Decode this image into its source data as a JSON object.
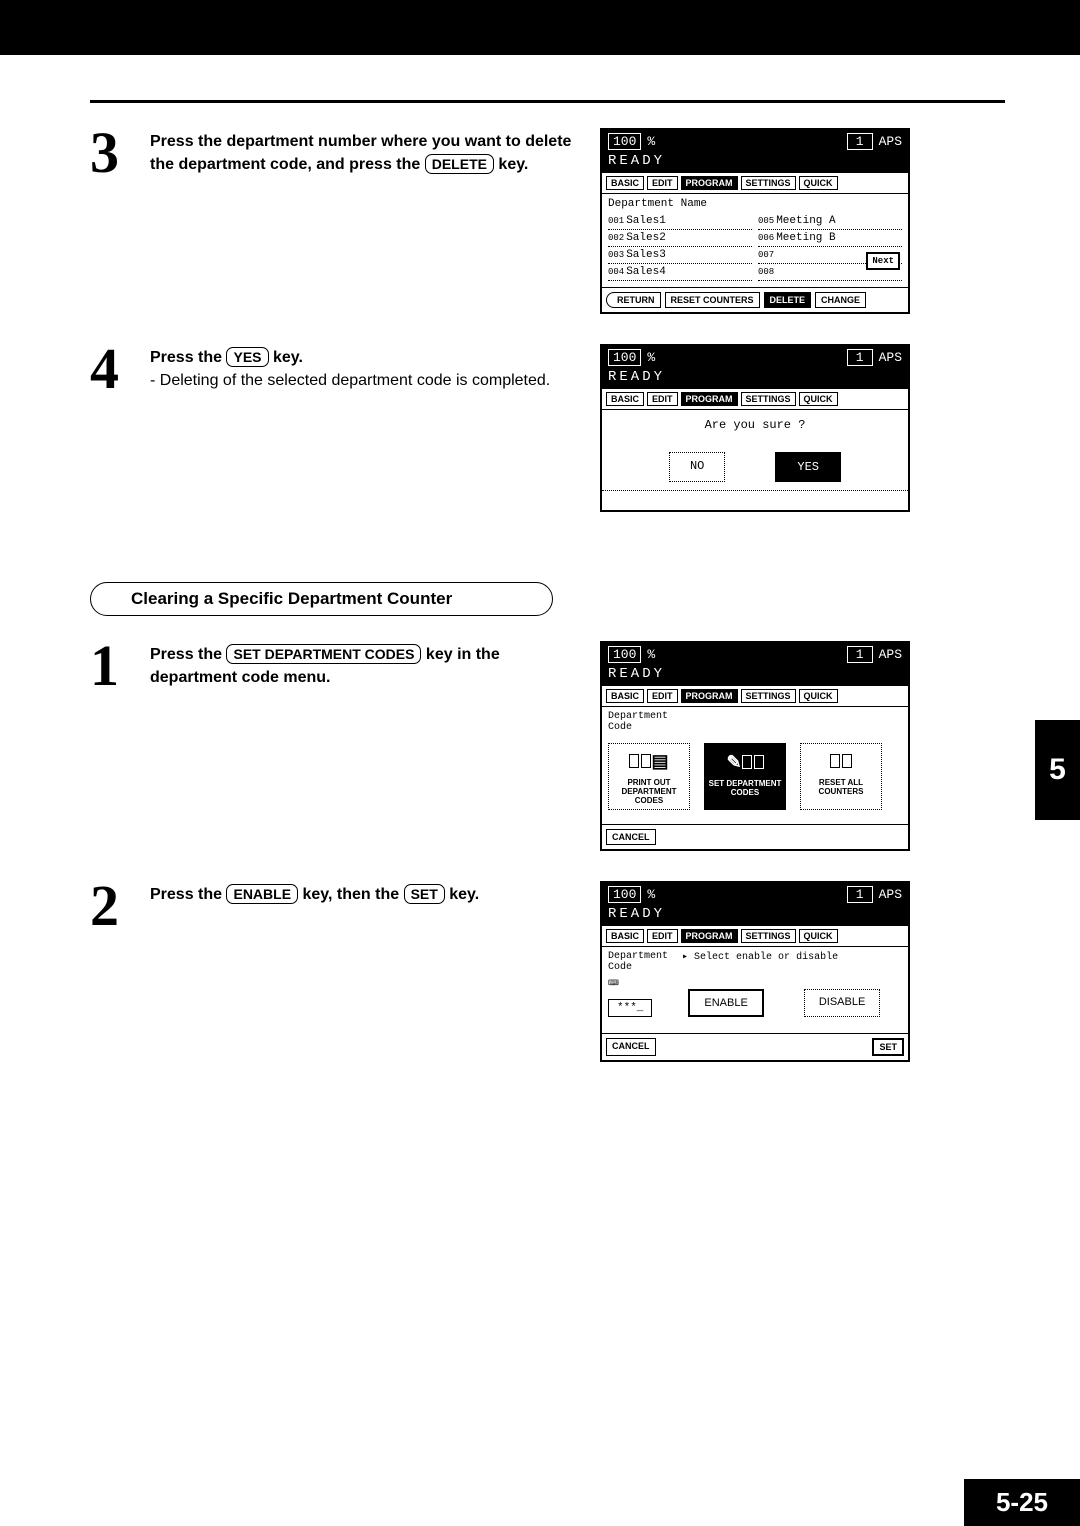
{
  "steps": {
    "s3": {
      "num": "3",
      "text_a": "Press the department number where you want to delete the department code, and press the ",
      "key": "DELETE",
      "text_b": " key."
    },
    "s4": {
      "num": "4",
      "text_a": "Press the ",
      "key": "YES",
      "text_b": " key.",
      "sub": "- Deleting of the selected department code is completed."
    },
    "heading": "Clearing a Specific Department Counter",
    "s1b": {
      "num": "1",
      "text_a": "Press the ",
      "key": "SET DEPARTMENT CODES",
      "text_b": " key in the department code menu."
    },
    "s2b": {
      "num": "2",
      "text_a": "Press the ",
      "key1": "ENABLE",
      "text_mid": " key, then the ",
      "key2": "SET",
      "text_b": " key."
    }
  },
  "panel": {
    "pct": "100",
    "pct_sym": "%",
    "copies": "1",
    "aps": "APS",
    "ready": "READY",
    "tabs": [
      "BASIC",
      "EDIT",
      "PROGRAM",
      "SETTINGS",
      "QUICK"
    ],
    "dept_name": "Department Name",
    "dept_code": "Department\nCode",
    "items_l": [
      {
        "n": "001",
        "t": "Sales1"
      },
      {
        "n": "002",
        "t": "Sales2"
      },
      {
        "n": "003",
        "t": "Sales3"
      },
      {
        "n": "004",
        "t": "Sales4"
      }
    ],
    "items_r": [
      {
        "n": "005",
        "t": "Meeting A"
      },
      {
        "n": "006",
        "t": "Meeting B"
      },
      {
        "n": "007",
        "t": ""
      },
      {
        "n": "008",
        "t": ""
      }
    ],
    "next": "Next",
    "footer1": [
      "RETURN",
      "RESET COUNTERS",
      "DELETE",
      "CHANGE"
    ],
    "sure": "Are you sure ?",
    "no": "NO",
    "yes": "YES",
    "big_btns": [
      "PRINT OUT DEPARTMENT CODES",
      "SET DEPARTMENT CODES",
      "RESET ALL COUNTERS"
    ],
    "cancel": "CANCEL",
    "prompt": "Select enable or disable",
    "enable": "ENABLE",
    "disable": "DISABLE",
    "set": "SET",
    "mask": "***_"
  },
  "side_tab": "5",
  "page_num": "5-25"
}
